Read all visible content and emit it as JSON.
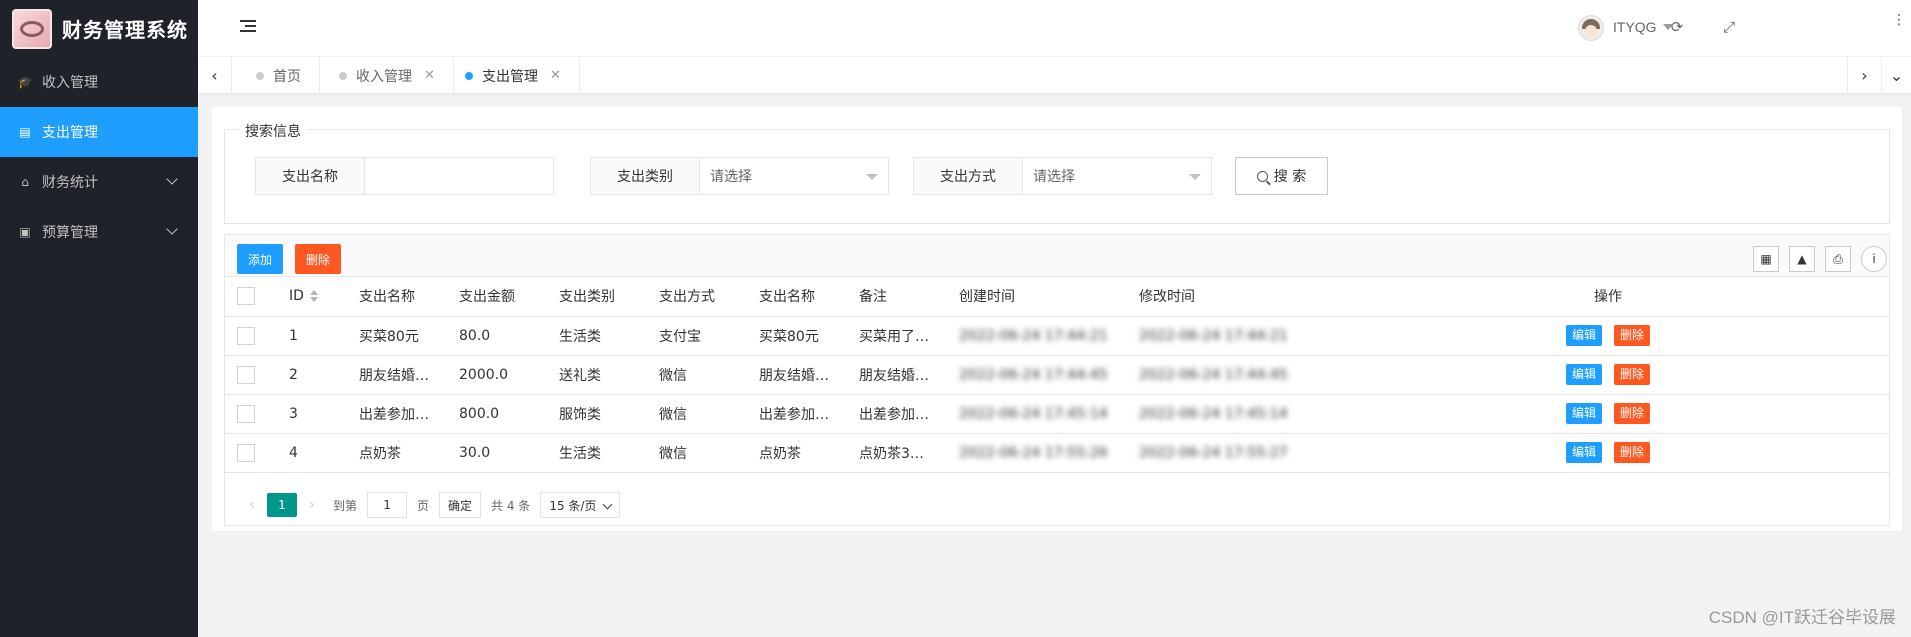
{
  "app": {
    "title": "财务管理系统"
  },
  "sidebar": {
    "items": [
      {
        "label": "收入管理",
        "icon": "graduation-cap-icon",
        "active": false
      },
      {
        "label": "支出管理",
        "icon": "table-icon",
        "active": true
      },
      {
        "label": "财务统计",
        "icon": "home-icon",
        "active": false,
        "expandable": true
      },
      {
        "label": "预算管理",
        "icon": "window-icon",
        "active": false,
        "expandable": true
      }
    ]
  },
  "header": {
    "user": "ITYQG"
  },
  "tabs": [
    {
      "label": "首页",
      "active": false,
      "closable": false
    },
    {
      "label": "收入管理",
      "active": false,
      "closable": true
    },
    {
      "label": "支出管理",
      "active": true,
      "closable": true
    }
  ],
  "search": {
    "legend": "搜索信息",
    "fields": [
      {
        "label": "支出名称",
        "value": ""
      },
      {
        "label": "支出类别",
        "value": "请选择"
      },
      {
        "label": "支出方式",
        "value": "请选择"
      }
    ],
    "button_label": "搜 索"
  },
  "toolbar": {
    "add_label": "添加",
    "delete_label": "删除"
  },
  "table": {
    "columns": [
      "ID",
      "支出名称",
      "支出金额",
      "支出类别",
      "支出方式",
      "支出名称",
      "备注",
      "创建时间",
      "修改时间",
      "操作"
    ],
    "rows": [
      [
        "1",
        "买菜80元",
        "80.0",
        "生活类",
        "支付宝",
        "买菜80元",
        "买菜用了…",
        "2022-06-24 17:44:21",
        "2022-06-24 17:44:21"
      ],
      [
        "2",
        "朋友结婚…",
        "2000.0",
        "送礼类",
        "微信",
        "朋友结婚…",
        "朋友结婚…",
        "2022-06-24 17:44:45",
        "2022-06-24 17:44:45"
      ],
      [
        "3",
        "出差参加…",
        "800.0",
        "服饰类",
        "微信",
        "出差参加…",
        "出差参加…",
        "2022-06-24 17:45:14",
        "2022-06-24 17:45:14"
      ],
      [
        "4",
        "点奶茶",
        "30.0",
        "生活类",
        "微信",
        "点奶茶",
        "点奶茶3…",
        "2022-06-24 17:55:26",
        "2022-06-24 17:55:27"
      ]
    ],
    "row_edit_label": "编辑",
    "row_delete_label": "删除"
  },
  "pager": {
    "current": "1",
    "goto_label": "到第",
    "goto_value": "1",
    "page_label": "页",
    "confirm_label": "确定",
    "total_label": "共 4 条",
    "page_size": "15 条/页"
  },
  "watermark": "CSDN @IT跃迁谷毕设展",
  "colors": {
    "sidebar": "#20222a",
    "accent": "#1e9fff",
    "danger": "#ff5722",
    "pager": "#009688"
  }
}
